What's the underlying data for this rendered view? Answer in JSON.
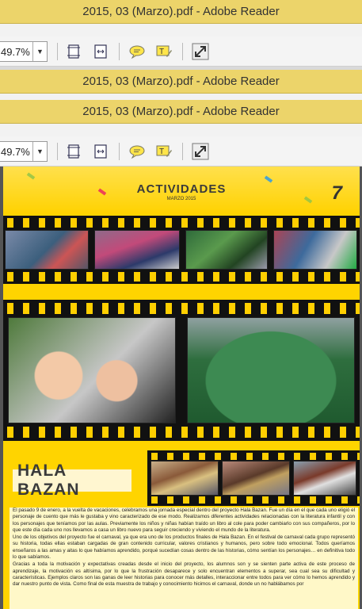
{
  "window": {
    "title_1": "2015, 03 (Marzo).pdf - Adobe Reader",
    "title_2": "2015, 03 (Marzo).pdf - Adobe Reader",
    "title_3": "2015, 03 (Marzo).pdf - Adobe Reader"
  },
  "toolbar_1": {
    "zoom_value": "49.7%"
  },
  "toolbar_2": {
    "zoom_value": "49.7%"
  },
  "icons": [
    "fit-page-icon",
    "fit-width-icon",
    "comment-icon",
    "highlight-text-icon",
    "fullscreen-icon"
  ],
  "document": {
    "section_title": "ACTIVIDADES",
    "month": "MARZO 2015",
    "page_number": "7",
    "article_title": "HALA BAZAN",
    "paragraphs": [
      "El pasado 9 de enero, a la vuelta de vacaciones, celebramos una jornada especial dentro del proyecto Hala Bazan. Fue un día en el que cada uno eligió el personaje de cuento que más le gustaba y vino caracterizado de ese modo. Realizamos diferentes actividades relacionadas con la literatura infantil y con los personajes que teníamos por las aulas. Previamente los niños y niñas habían traído un libro al cole para poder cambiarlo con sus compañeros, por lo que este día cada uno nos llevamos a casa un libro nuevo para seguir creciendo y viviendo el mundo de la literatura.",
      "Uno de los objetivos del proyecto fue el carnaval, ya que era uno de los productos finales de Hala Bazan. En el festival de carnaval cada grupo representó su historia, todas ellas estaban cargadas de gran contenido curricular, valores cristianos y humanos, pero sobre todo emocional. Todos queríamos enseñaros a las amas y aitas lo que habíamos aprendido, porqué sucedían cosas dentro de las historias, cómo sentían los personajes… en definitiva todo lo que sabíamos.",
      "Gracias a toda la motivación y expectativas creadas desde el inicio del proyecto, los alumnos son y se sienten parte activa de este proceso de aprendizaje, la motivación es altísima, por lo que la frustración desaparece y solo encuentran elementos a superar, sea cual sea su dificultad y características. Ejemplos claros son las ganas de leer historias para conocer más detalles, interaccionar entre todos para ver cómo lo hemos aprendido y dar nuestro punto de vista. Como final de esta muestra de trabajo y conocimiento hicimos el carnaval, donde un no hablábamos por"
    ]
  }
}
